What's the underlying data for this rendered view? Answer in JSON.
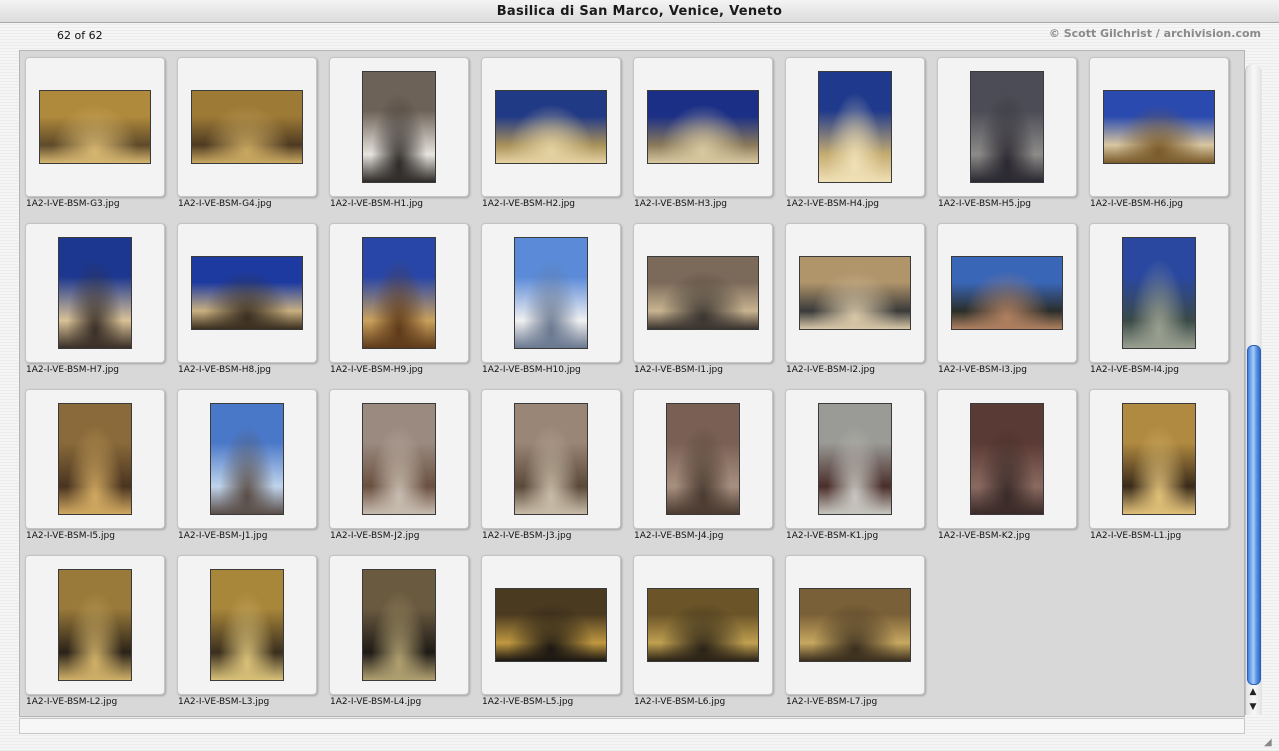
{
  "window": {
    "title": "Basilica di San Marco, Venice, Veneto",
    "count_label": "62 of 62",
    "credit": "© Scott Gilchrist / archivision.com"
  },
  "scrollbar": {
    "up_icon": "arrow-up-icon",
    "down_icon": "arrow-down-icon",
    "position_fraction": 0.45
  },
  "thumbnails": [
    {
      "file": "1A2-I-VE-BSM-G3.jpg",
      "orient": "land",
      "colors": [
        "#b08a3c",
        "#5e4a2a",
        "#d6b670"
      ]
    },
    {
      "file": "1A2-I-VE-BSM-G4.jpg",
      "orient": "land",
      "colors": [
        "#9d7a36",
        "#4e3a22",
        "#c9a860"
      ]
    },
    {
      "file": "1A2-I-VE-BSM-H1.jpg",
      "orient": "port",
      "colors": [
        "#6d6257",
        "#e7e3dd",
        "#2e2a28"
      ]
    },
    {
      "file": "1A2-I-VE-BSM-H2.jpg",
      "orient": "land",
      "colors": [
        "#213a86",
        "#a8915a",
        "#e5d2a2"
      ]
    },
    {
      "file": "1A2-I-VE-BSM-H3.jpg",
      "orient": "land",
      "colors": [
        "#1b2f86",
        "#8a7a5a",
        "#d8c8a0"
      ]
    },
    {
      "file": "1A2-I-VE-BSM-H4.jpg",
      "orient": "port",
      "colors": [
        "#1f3a8c",
        "#c5ac70",
        "#f0e0b6"
      ]
    },
    {
      "file": "1A2-I-VE-BSM-H5.jpg",
      "orient": "port",
      "colors": [
        "#4b4c55",
        "#8d8b88",
        "#2a2830"
      ]
    },
    {
      "file": "1A2-I-VE-BSM-H6.jpg",
      "orient": "land",
      "colors": [
        "#2a4ab0",
        "#d8c6a0",
        "#7a5a2a"
      ]
    },
    {
      "file": "1A2-I-VE-BSM-H7.jpg",
      "orient": "port",
      "colors": [
        "#1c3790",
        "#d9c296",
        "#3a2f28"
      ]
    },
    {
      "file": "1A2-I-VE-BSM-H8.jpg",
      "orient": "land",
      "colors": [
        "#1c3aa0",
        "#c9b080",
        "#3a2e20"
      ]
    },
    {
      "file": "1A2-I-VE-BSM-H9.jpg",
      "orient": "port",
      "colors": [
        "#2846a8",
        "#caa15c",
        "#5e3a1a"
      ]
    },
    {
      "file": "1A2-I-VE-BSM-H10.jpg",
      "orient": "port",
      "colors": [
        "#5a8ad8",
        "#f0f0f0",
        "#6a7890"
      ]
    },
    {
      "file": "1A2-I-VE-BSM-I1.jpg",
      "orient": "land",
      "colors": [
        "#7b6a5a",
        "#c9b490",
        "#3a3430"
      ]
    },
    {
      "file": "1A2-I-VE-BSM-I2.jpg",
      "orient": "land",
      "colors": [
        "#b0946a",
        "#3a3a3a",
        "#d8c8a8"
      ]
    },
    {
      "file": "1A2-I-VE-BSM-I3.jpg",
      "orient": "land",
      "colors": [
        "#3a66b8",
        "#2a2e2a",
        "#b08060"
      ]
    },
    {
      "file": "1A2-I-VE-BSM-I4.jpg",
      "orient": "port",
      "colors": [
        "#2a48a0",
        "#3a4a48",
        "#9aa090"
      ]
    },
    {
      "file": "1A2-I-VE-BSM-I5.jpg",
      "orient": "port",
      "colors": [
        "#8a6a3a",
        "#4a3420",
        "#d0a860"
      ]
    },
    {
      "file": "1A2-I-VE-BSM-J1.jpg",
      "orient": "port",
      "colors": [
        "#4a78c8",
        "#c0d4ec",
        "#5a4e48"
      ]
    },
    {
      "file": "1A2-I-VE-BSM-J2.jpg",
      "orient": "port",
      "colors": [
        "#9a8a80",
        "#6a5040",
        "#c8bcb0"
      ]
    },
    {
      "file": "1A2-I-VE-BSM-J3.jpg",
      "orient": "port",
      "colors": [
        "#9a8676",
        "#5a4838",
        "#c8bca8"
      ]
    },
    {
      "file": "1A2-I-VE-BSM-J4.jpg",
      "orient": "port",
      "colors": [
        "#7a6054",
        "#a89080",
        "#4a3a30"
      ]
    },
    {
      "file": "1A2-I-VE-BSM-K1.jpg",
      "orient": "port",
      "colors": [
        "#9a9a96",
        "#4a2e2a",
        "#c8c6c0"
      ]
    },
    {
      "file": "1A2-I-VE-BSM-K2.jpg",
      "orient": "port",
      "colors": [
        "#5a3a34",
        "#8a6a60",
        "#3a2a28"
      ]
    },
    {
      "file": "1A2-I-VE-BSM-L1.jpg",
      "orient": "port",
      "colors": [
        "#b08a40",
        "#3a2a1a",
        "#e0c078"
      ]
    },
    {
      "file": "1A2-I-VE-BSM-L2.jpg",
      "orient": "port",
      "colors": [
        "#9a7a3a",
        "#2a2218",
        "#d0b068"
      ]
    },
    {
      "file": "1A2-I-VE-BSM-L3.jpg",
      "orient": "port",
      "colors": [
        "#a8863a",
        "#3a2e1e",
        "#d8c078"
      ]
    },
    {
      "file": "1A2-I-VE-BSM-L4.jpg",
      "orient": "port",
      "colors": [
        "#6a5a40",
        "#1e1a16",
        "#b0a070"
      ]
    },
    {
      "file": "1A2-I-VE-BSM-L5.jpg",
      "orient": "land",
      "colors": [
        "#4a3a20",
        "#c09840",
        "#1a1612"
      ]
    },
    {
      "file": "1A2-I-VE-BSM-L6.jpg",
      "orient": "land",
      "colors": [
        "#6a5428",
        "#c0a050",
        "#2a2216"
      ]
    },
    {
      "file": "1A2-I-VE-BSM-L7.jpg",
      "orient": "land",
      "colors": [
        "#7a6038",
        "#c8a860",
        "#3a2e1e"
      ]
    }
  ]
}
